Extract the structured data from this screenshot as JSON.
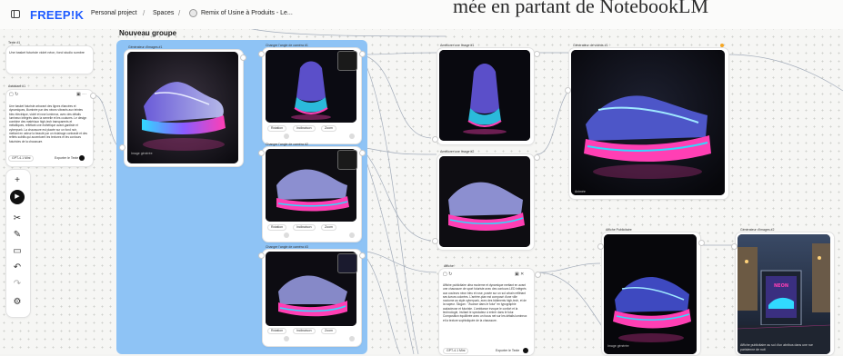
{
  "topbar": {
    "logo": "FREEP!K",
    "crumb1": "Personal project",
    "sep": "/",
    "crumb2": "Spaces",
    "crumb3": "Remix of Usine à Produits - Le..."
  },
  "overlay": {
    "text": "mée en partant de NotebookLM"
  },
  "group": {
    "title": "Nouveau groupe"
  },
  "text_node": {
    "label": "Texte #1",
    "body": "Une basket futuriste violet néon, fond studio sombre"
  },
  "assistant_node": {
    "label": "Assistant #1",
    "body": "Une basket futuriste arborant des lignes élancées et dynamiques, illuminée par des néons vibrants aux teintes bleu électrique, violet et rose lumineux, avec des détails lumineux intégrés dans la semelle et les coutures. Le design combine des matériaux high-tech transparents et métalliques, reflétant une esthétique avant-gardiste et cyberpunk. La chaussure est placée sur un fond noir, mettant en valeur la beauté par un éclairage contrasté et des reflets subtils qui accentuent les textures et les contours futuristes de la chaussure.",
    "model": "GPT-4.1 Mini",
    "action": "Exporter le Texte"
  },
  "gen1": {
    "label": "Générateur d'images #1",
    "caption": "Image générée"
  },
  "angle1": {
    "label": "Changer l'angle de caméra #1",
    "opt1": "Rotation",
    "opt2": "Inclinaison",
    "opt3": "Zoom"
  },
  "angle2": {
    "label": "Changer l'angle de caméra #2",
    "opt1": "Rotation",
    "opt2": "Inclinaison",
    "opt3": "Zoom"
  },
  "angle3": {
    "label": "Changer l'angle de caméra #3",
    "opt1": "Rotation",
    "opt2": "Inclinaison",
    "opt3": "Zoom"
  },
  "upscale1": {
    "label": "Améliorer une Image #1"
  },
  "upscale2": {
    "label": "Améliorer une Image #2"
  },
  "video_gen": {
    "label": "Générateur de vidéos #1",
    "caption": "Animée"
  },
  "affiche_node": {
    "label": "Affiche",
    "body": "Affiche publicitaire ultra moderne et dynamique mettant en avant une chaussure de sport futuriste avec des contours LED intégrés aux couleurs néon bleu et rose, posée sur un sol urbain reflétant ses lueurs colorées. L'arrière-plan est composé d'une ville nocturne au style cyberpunk, avec des bâtiments high-tech, et de la vapeur. Slogan : \"Avance dans le futur\" en typographie audacieuse et futuriste. L'ambiance évoque le confort et la technologie, invitant le spectateur à entrer dans le futur. Composition équilibrée avec un focus net sur les détails lumineux et la texture sophistiquée de la chaussure.",
    "model": "GPT-4.1 Mini",
    "action": "Exporter le Texte"
  },
  "affiche_pub": {
    "label": "Affiche Publicitaire",
    "caption": "Image générée"
  },
  "gen2": {
    "label": "Générateur d'images #2",
    "caption": "Affiche publicitaire au sol d'un abribus dans une rue parisienne de nuit"
  },
  "toolbar": {
    "plus": "+",
    "play": "▶",
    "cut": "✂",
    "pen": "✎",
    "comment": "▭",
    "undo": "↶",
    "redo": "↷",
    "settings": "⚙"
  },
  "colors": {
    "accent": "#1e5bff",
    "group_bg": "#8ec3f5",
    "neon_pink": "#ff3fb4",
    "neon_cyan": "#31d9ff",
    "neon_violet": "#8a5cff"
  }
}
